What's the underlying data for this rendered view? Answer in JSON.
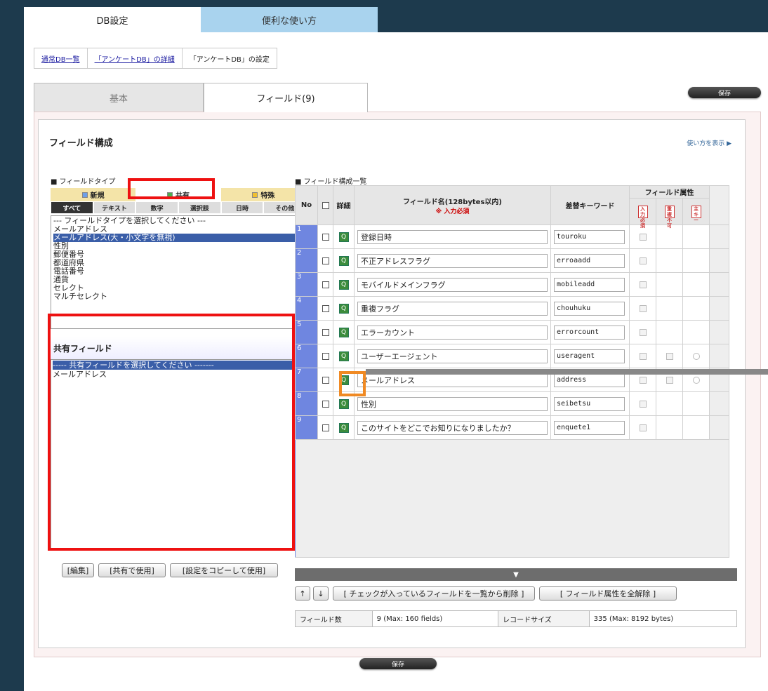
{
  "top_tabs": [
    "DB設定",
    "便利な使い方"
  ],
  "breadcrumbs": [
    "通常DB一覧",
    "「アンケートDB」の詳細",
    "「アンケートDB」の設定"
  ],
  "save_label": "保存",
  "sub_tabs": [
    "基本",
    "フィールド(9)"
  ],
  "section_title": "フィールド構成",
  "howto_link": "使い方を表示 ▶",
  "field_type_label": "■ フィールドタイプ",
  "field_types": [
    "新規",
    "共有",
    "特殊"
  ],
  "sub_types": [
    "すべて",
    "テキスト",
    "数字",
    "選択肢",
    "日時",
    "その他"
  ],
  "type_list": [
    "--- フィールドタイプを選択してください ---",
    "メールアドレス",
    "メールアドレス(大・小文字を無視)",
    "性別",
    "郵便番号",
    "都道府県",
    "電話番号",
    "通貨",
    "セレクト",
    "マルチセレクト"
  ],
  "type_list_selected": 2,
  "shared_title": "共有フィールド",
  "shared_list": [
    "----- 共有フィールドを選択してください -------",
    "メールアドレス"
  ],
  "left_buttons": [
    "[編集]",
    "[共有で使用]",
    "[設定をコピーして使用]"
  ],
  "field_list_label": "■ フィールド構成一覧",
  "table_headers": {
    "no": "No",
    "detail": "詳細",
    "name": "フィールド名(128bytes以内)",
    "required": "※ 入力必須",
    "keyword": "差替キーワード",
    "attr": "フィールド属性",
    "attr_icons": [
      "入力必須",
      "重複不可",
      "主キー"
    ]
  },
  "fields": [
    {
      "no": "1",
      "name": "登録日時",
      "kw": "touroku",
      "attrs": 1
    },
    {
      "no": "2",
      "name": "不正アドレスフラグ",
      "kw": "erroaadd",
      "attrs": 1
    },
    {
      "no": "3",
      "name": "モバイルドメインフラグ",
      "kw": "mobileadd",
      "attrs": 1
    },
    {
      "no": "4",
      "name": "重複フラグ",
      "kw": "chouhuku",
      "attrs": 1
    },
    {
      "no": "5",
      "name": "エラーカウント",
      "kw": "errorcount",
      "attrs": 1
    },
    {
      "no": "6",
      "name": "ユーザーエージェント",
      "kw": "useragent",
      "attrs": 3
    },
    {
      "no": "7",
      "name": "メールアドレス",
      "kw": "address",
      "attrs": 3
    },
    {
      "no": "8",
      "name": "性別",
      "kw": "seibetsu",
      "attrs": 1
    },
    {
      "no": "9",
      "name": "このサイトをどこでお知りになりましたか？",
      "kw": "enquete1",
      "attrs": 1
    }
  ],
  "drag_arrow": "▼",
  "bottom_buttons": [
    "↑",
    "↓",
    "[ チェックが入っているフィールドを一覧から削除 ]",
    "[ フィールド属性を全解除 ]"
  ],
  "info": {
    "field_count_label": "フィールド数",
    "field_count": "9 (Max: 160 fields)",
    "record_size_label": "レコードサイズ",
    "record_size": "335 (Max: 8192 bytes)"
  }
}
